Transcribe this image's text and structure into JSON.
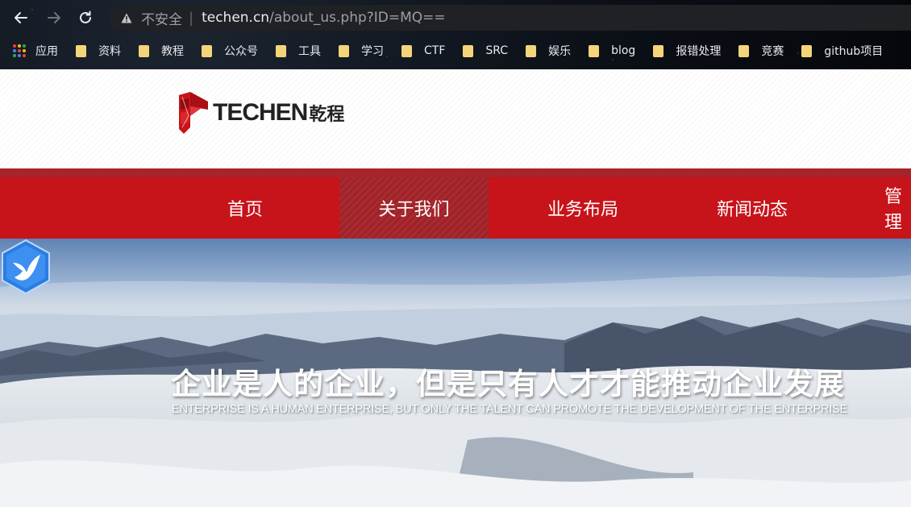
{
  "browser": {
    "nav": {
      "back_icon": "arrow-left-icon",
      "forward_icon": "arrow-right-icon",
      "reload_icon": "reload-icon"
    },
    "security_label": "不安全",
    "url_host": "techen.cn",
    "url_path": "/about_us.php?ID=MQ==",
    "bookmarks": [
      {
        "label": "应用",
        "icon": "apps-grid-icon"
      },
      {
        "label": "资料",
        "icon": "folder-icon"
      },
      {
        "label": "教程",
        "icon": "folder-icon"
      },
      {
        "label": "公众号",
        "icon": "folder-icon"
      },
      {
        "label": "工具",
        "icon": "folder-icon"
      },
      {
        "label": "学习",
        "icon": "folder-icon"
      },
      {
        "label": "CTF",
        "icon": "folder-icon"
      },
      {
        "label": "SRC",
        "icon": "folder-icon"
      },
      {
        "label": "娱乐",
        "icon": "folder-icon"
      },
      {
        "label": "blog",
        "icon": "folder-icon"
      },
      {
        "label": "报错处理",
        "icon": "folder-icon"
      },
      {
        "label": "竞赛",
        "icon": "folder-icon"
      },
      {
        "label": "github项目",
        "icon": "folder-icon"
      }
    ]
  },
  "site": {
    "logo_text": "TECHEN",
    "logo_cn": "乾程",
    "nav": [
      {
        "label": "首页",
        "active": false
      },
      {
        "label": "关于我们",
        "active": true
      },
      {
        "label": "业务布局",
        "active": false
      },
      {
        "label": "新闻动态",
        "active": false
      },
      {
        "label": "管理",
        "active": false
      }
    ],
    "hero": {
      "title": "企业是人的企业，但是只有人才才能推动企业发展",
      "subtitle": "ENTERPRISE IS A HUMAN ENTERPRISE, BUT ONLY THE TALENT CAN PROMOTE THE DEVELOPMENT OF THE ENTERPRISE"
    }
  },
  "colors": {
    "brand_red": "#c7131a",
    "nav_active": "#a92a30",
    "folder": "#f5d57a"
  }
}
